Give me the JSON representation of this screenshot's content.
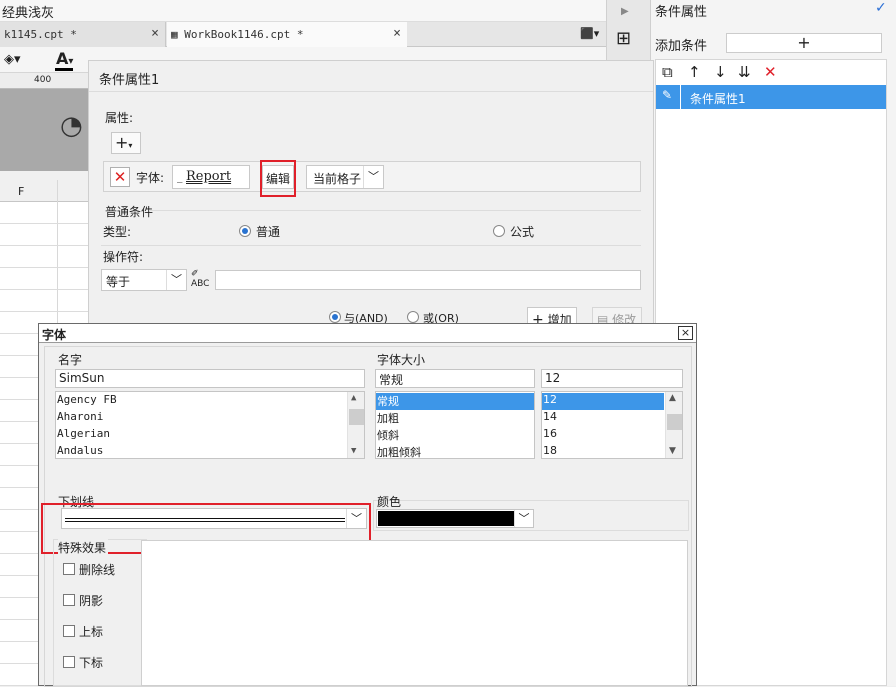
{
  "app": {
    "theme_name": "经典浅灰"
  },
  "tabs": [
    {
      "label": "k1145.cpt *",
      "close": "×"
    },
    {
      "label": "WorkBook1146.cpt *",
      "close": "×"
    }
  ],
  "ruler": {
    "mark": "400"
  },
  "sheet": {
    "column": "F"
  },
  "right_panel": {
    "title": "条件属性",
    "add_condition_label": "添加条件",
    "add_button": "+",
    "items": [
      {
        "label": "条件属性1"
      }
    ]
  },
  "cond_dialog": {
    "title": "条件属性1",
    "attributes_label": "属性:",
    "add_attr": "+",
    "font_label": "字体:",
    "preview_text": "Report",
    "edit_button": "编辑",
    "scope_value": "当前格子",
    "normal_condition_label": "普通条件",
    "type_label": "类型:",
    "type_normal": "普通",
    "type_formula": "公式",
    "operator_label": "操作符:",
    "operator_value": "等于",
    "and_label": "与(AND)",
    "or_label": "或(OR)",
    "add_button": "增加",
    "modify_button": "修改"
  },
  "font_dialog": {
    "title": "字体",
    "close": "×",
    "name_label": "名字",
    "name_value": "SimSun",
    "fonts": [
      "Agency FB",
      "Aharoni",
      "Algerian",
      "Andalus"
    ],
    "size_label": "字体大小",
    "style_value": "常规",
    "styles": [
      "常规",
      "加粗",
      "倾斜",
      "加粗倾斜"
    ],
    "size_value": "12",
    "sizes": [
      "12",
      "14",
      "16",
      "18"
    ],
    "underline_label": "下划线",
    "color_label": "颜色",
    "color_value": "#000000",
    "effects_label": "特殊效果",
    "effects": [
      "删除线",
      "阴影",
      "上标",
      "下标"
    ]
  },
  "colors": {
    "accent": "#3d96e8",
    "highlight": "#e0202a"
  }
}
